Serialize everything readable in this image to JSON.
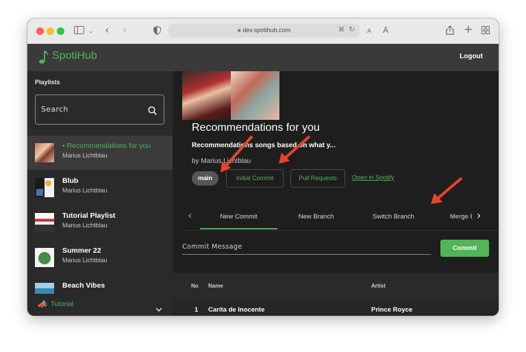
{
  "browser": {
    "url": "dev.spotihub.com",
    "traffic_colors": [
      "#ff5f57",
      "#febc2e",
      "#28c840"
    ]
  },
  "header": {
    "brand": "SpotiHub",
    "brand_icon": "music-note-icon",
    "logout": "Logout",
    "accent_color": "#4fb556"
  },
  "sidebar": {
    "title": "Playlists",
    "search_placeholder": "Search",
    "items": [
      {
        "name": "• Recommendations for you",
        "owner": "Marius Lichtblau",
        "active": true
      },
      {
        "name": "Blub",
        "owner": "Marius Lichtblau",
        "active": false
      },
      {
        "name": "Tutorial Playlist",
        "owner": "Marius Lichtblau",
        "active": false
      },
      {
        "name": "Summer 22",
        "owner": "Marius Lichtblau",
        "active": false
      },
      {
        "name": "Beach Vibes",
        "owner": "",
        "active": false
      }
    ],
    "tutorial": {
      "icon": "megaphone-icon",
      "label": "Tutorial"
    }
  },
  "playlist": {
    "title": "Recommendations for you",
    "description": "Recommendations songs based on what y...",
    "by": "by Marius Lichtblau",
    "branch": "main",
    "buttons": [
      "Initial Commit",
      "Pull Requests"
    ],
    "link": "Open in Spotify"
  },
  "tabs": {
    "items": [
      "New Commit",
      "New Branch",
      "Switch Branch",
      "Merge B"
    ],
    "active": "New Commit"
  },
  "commit": {
    "label": "Commit Message",
    "button": "Commit"
  },
  "table": {
    "headers": [
      "No",
      "Name",
      "Artist"
    ],
    "rows": [
      {
        "no": "1",
        "name": "Carita de Inocente",
        "artist": "Prince Royce"
      }
    ]
  }
}
